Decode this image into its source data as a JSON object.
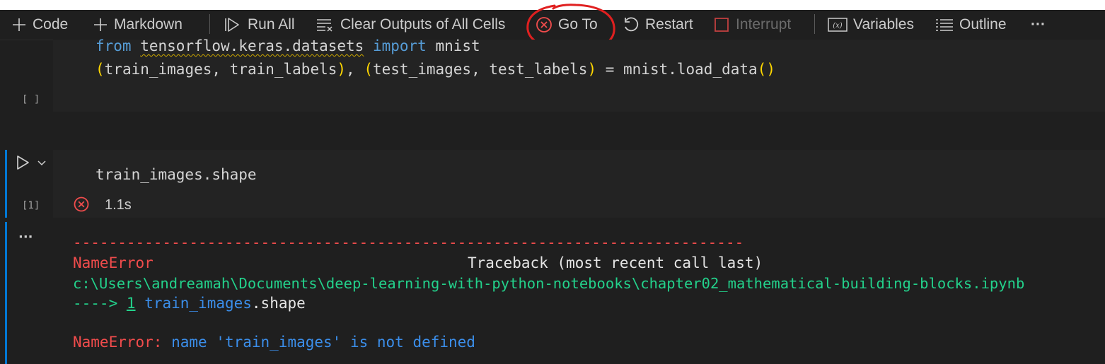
{
  "toolbar": {
    "code_label": "Code",
    "markdown_label": "Markdown",
    "run_all_label": "Run All",
    "clear_outputs_label": "Clear Outputs of All Cells",
    "goto_label": "Go To",
    "restart_label": "Restart",
    "interrupt_label": "Interrupt",
    "variables_label": "Variables",
    "outline_label": "Outline",
    "more_label": "···"
  },
  "cell1": {
    "line1": {
      "kw_from": "from",
      "module": "tensorflow.keras.datasets",
      "kw_import": "import",
      "name": "mnist"
    },
    "line2": {
      "p_open": "(",
      "a": "train_images, train_labels",
      "p_close": ")",
      "comma": ", ",
      "p2_open": "(",
      "b": "test_images, test_labels",
      "p2_close": ")",
      "assign": " = mnist.load_data",
      "call_open": "(",
      "call_close": ")"
    },
    "exec_count": "[ ]"
  },
  "cell2": {
    "code": "train_images.shape",
    "exec_count": "[1]",
    "duration": "1.1s"
  },
  "output": {
    "ellipsis": "···",
    "dashes": "---------------------------------------------------------------------------",
    "error_name": "NameError",
    "traceback_label": "Traceback (most recent call last)",
    "path": "c:\\Users\\andreamah\\Documents\\deep-learning-with-python-notebooks\\chapter02_mathematical-building-blocks.ipynb",
    "arrow": "---->",
    "line_no": "1",
    "line_code_a": "train_images",
    "line_code_b": ".shape",
    "final_err": "NameError:",
    "final_msg": " name 'train_images' is not defined"
  },
  "colors": {
    "accent_blue": "#0078d4",
    "error_red": "#f14c4c",
    "annotation_red": "#e02020"
  }
}
